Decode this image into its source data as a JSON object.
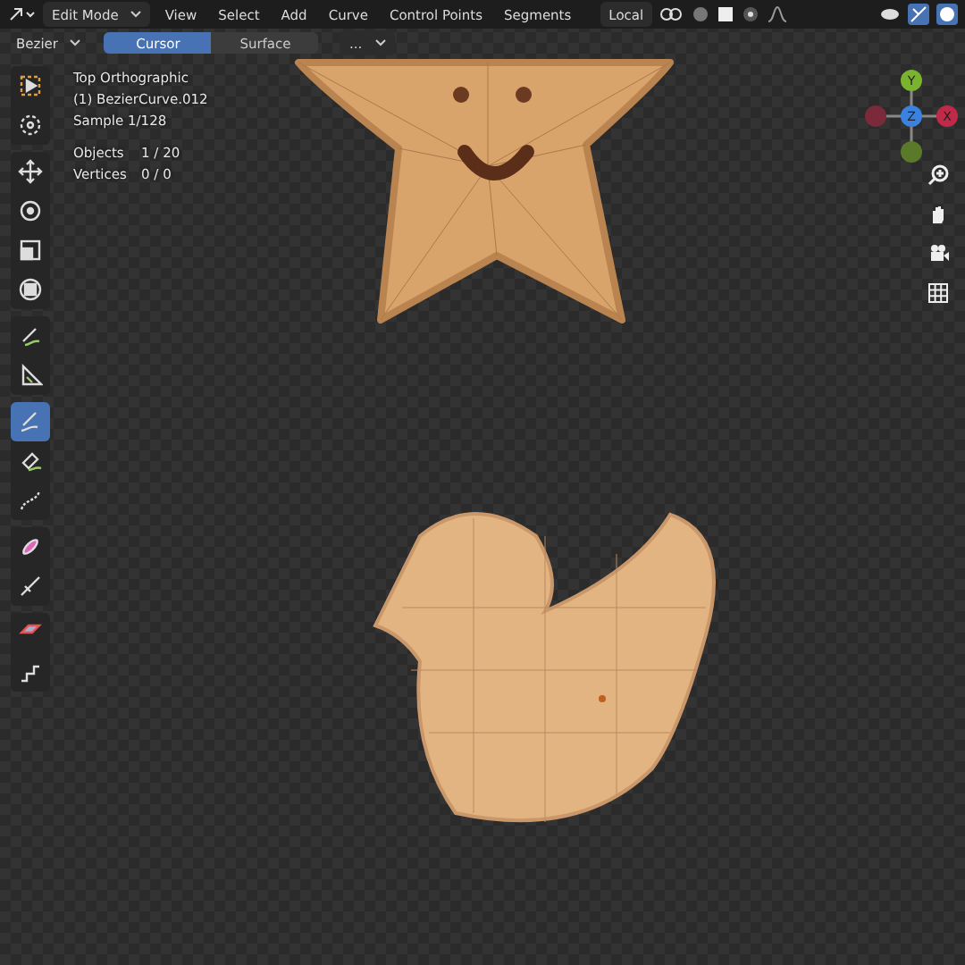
{
  "header": {
    "mode": "Edit Mode",
    "menus": [
      "View",
      "Select",
      "Add",
      "Curve",
      "Control Points",
      "Segments"
    ],
    "orientation": "Local"
  },
  "tool_settings": {
    "curve_type": "Bezier",
    "tabs": [
      {
        "label": "Cursor",
        "selected": true
      },
      {
        "label": "Surface",
        "selected": false
      }
    ],
    "more": "..."
  },
  "overlay_info": {
    "lines": [
      "Top Orthographic",
      "(1) BezierCurve.012",
      "Sample 1/128"
    ],
    "stats": [
      {
        "label": "Objects",
        "value": "1 / 20"
      },
      {
        "label": "Vertices",
        "value": "0 / 0"
      }
    ]
  },
  "gizmo": {
    "up": "Y",
    "center": "Z",
    "right": "X"
  },
  "tools": [
    {
      "kind": "select",
      "selected": false
    },
    {
      "kind": "cursor",
      "selected": false
    },
    {
      "kind": "move",
      "selected": false
    },
    {
      "kind": "rotate",
      "selected": false
    },
    {
      "kind": "scale",
      "selected": false
    },
    {
      "kind": "transform",
      "selected": false
    },
    {
      "kind": "annotate",
      "selected": false
    },
    {
      "kind": "measure",
      "selected": false
    },
    {
      "kind": "draw",
      "selected": true
    },
    {
      "kind": "pen",
      "selected": false
    },
    {
      "kind": "curve",
      "selected": false
    },
    {
      "kind": "tilt",
      "selected": false
    },
    {
      "kind": "radius",
      "selected": false
    },
    {
      "kind": "extrude",
      "selected": false
    },
    {
      "kind": "randomize",
      "selected": false
    }
  ]
}
